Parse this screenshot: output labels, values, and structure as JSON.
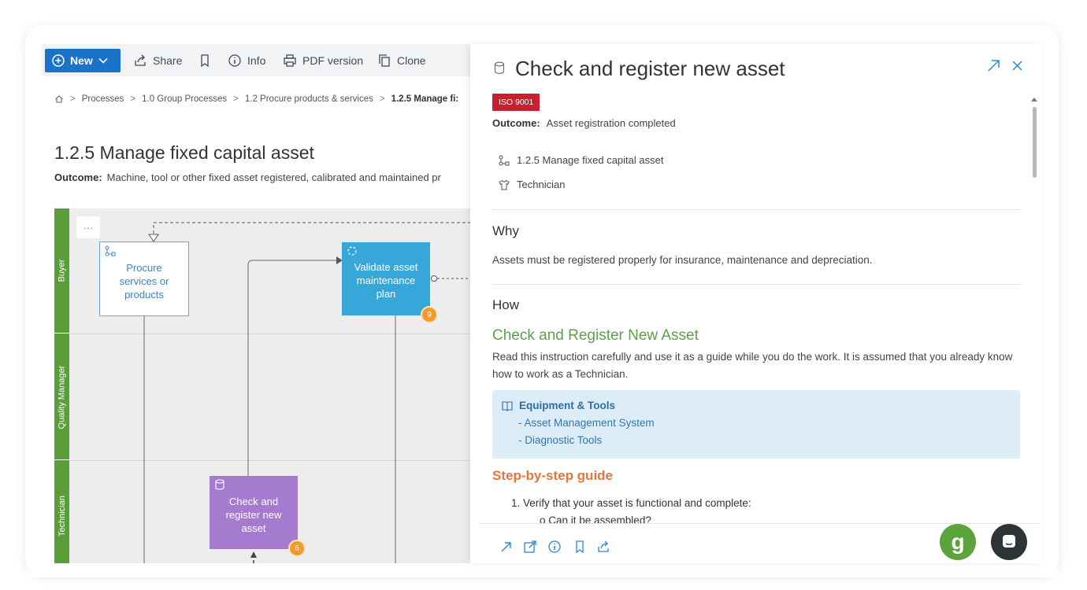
{
  "toolbar": {
    "new_label": "New",
    "share_label": "Share",
    "info_label": "Info",
    "pdf_label": "PDF version",
    "clone_label": "Clone"
  },
  "breadcrumb": [
    "Processes",
    "1.0 Group Processes",
    "1.2 Procure products & services",
    "1.2.5 Manage fi:"
  ],
  "page": {
    "title": "1.2.5 Manage fixed capital asset",
    "outcome_label": "Outcome:",
    "outcome_value": "Machine, tool or other fixed asset registered, calibrated and maintained pr"
  },
  "diagram": {
    "more": "···",
    "lanes": [
      "Buyer",
      "Quality Manager",
      "Technician"
    ],
    "boxes": {
      "procure": "Procure services or products",
      "validate": "Validate asset maintenance plan",
      "check": "Check and register new asset"
    },
    "badges": {
      "validate": "9",
      "check": "6"
    }
  },
  "panel": {
    "title": "Check and register new asset",
    "tag": "ISO 9001",
    "outcome_label": "Outcome:",
    "outcome_value": "Asset registration completed",
    "process_link": "1.2.5 Manage fixed capital asset",
    "role": "Technician",
    "why_heading": "Why",
    "why_text": "Assets must be registered properly for insurance, maintenance and depreciation.",
    "how_heading": "How",
    "instruction_title": "Check and Register New Asset",
    "instruction_text": "Read this instruction carefully and use it as a guide while you do the work. It is assumed that you already know how to work as a Technician.",
    "tools_title": "Equipment & Tools",
    "tools": [
      "- Asset Management System",
      "- Diagnostic Tools"
    ],
    "guide_heading": "Step-by-step guide",
    "step1": "1. Verify that your asset is functional and complete:",
    "step1_sub": "o   Can it be assembled?"
  },
  "fab": {
    "g_label": "g"
  },
  "colors": {
    "accent_blue": "#1a73c8",
    "iso_red": "#c8202f",
    "lane_green": "#5a9e3a",
    "heading_green": "#5ba147",
    "heading_orange": "#e2753c",
    "validate_box": "#36a7d8",
    "check_box": "#a57bd0",
    "badge_orange": "#f39a2c"
  }
}
